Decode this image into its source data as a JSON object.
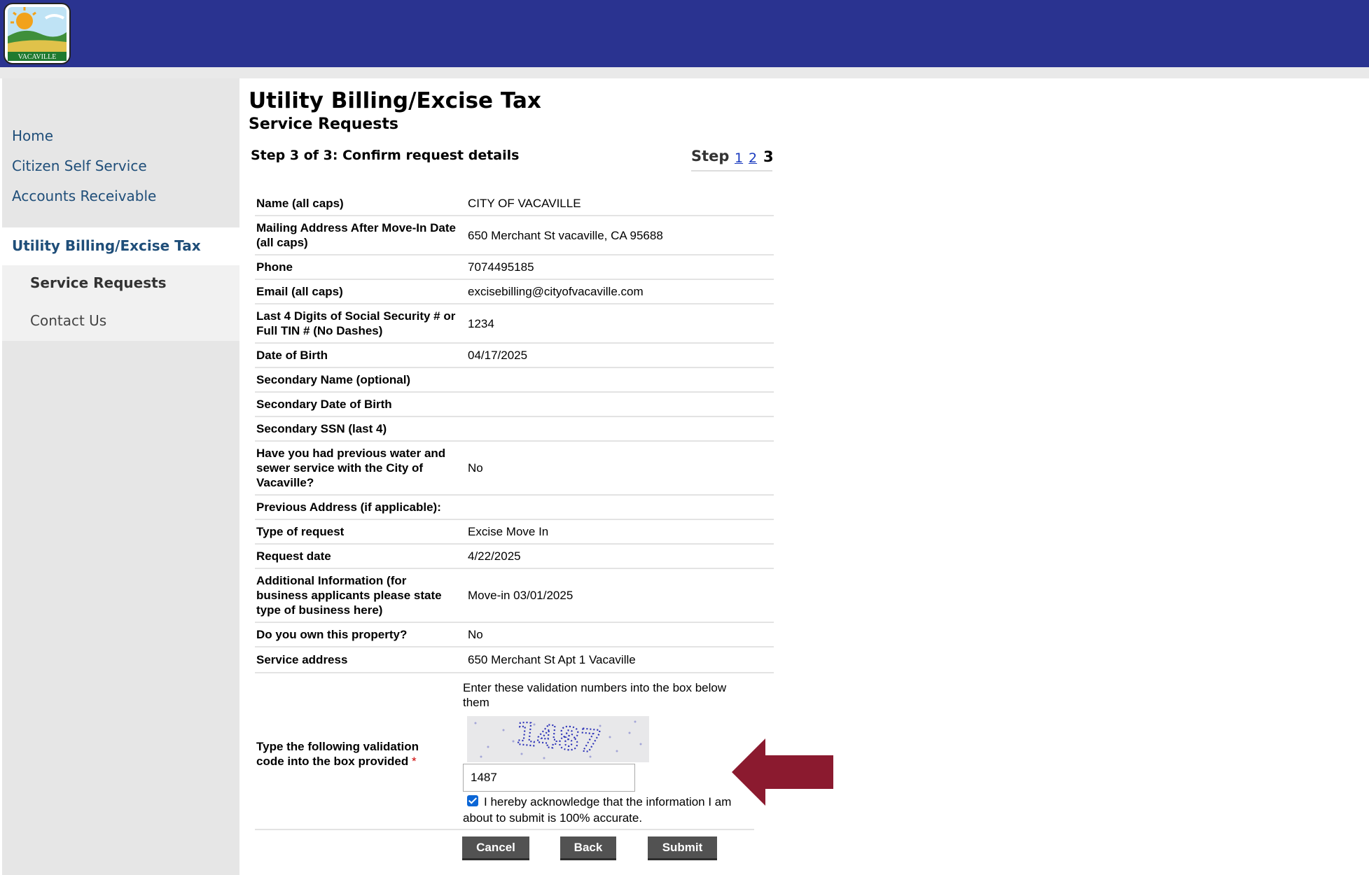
{
  "header": {
    "logo_text": "VACAVILLE"
  },
  "sidebar": {
    "items": [
      {
        "label": "Home"
      },
      {
        "label": "Citizen Self Service"
      },
      {
        "label": "Accounts Receivable"
      },
      {
        "label": "Utility Billing/Excise Tax"
      }
    ],
    "subitems": [
      {
        "label": "Service Requests"
      },
      {
        "label": "Contact Us"
      }
    ]
  },
  "main": {
    "title": "Utility Billing/Excise Tax",
    "subtitle": "Service Requests",
    "step_title": "Step 3 of 3: Confirm request details",
    "step_nav": {
      "label": "Step",
      "links": [
        "1",
        "2"
      ],
      "current": "3"
    }
  },
  "details": [
    {
      "label": "Name (all caps)",
      "value": "CITY OF VACAVILLE"
    },
    {
      "label": "Mailing Address After Move-In Date (all caps)",
      "value": "650 Merchant St vacaville, CA 95688"
    },
    {
      "label": "Phone",
      "value": "7074495185"
    },
    {
      "label": "Email (all caps)",
      "value": "excisebilling@cityofvacaville.com"
    },
    {
      "label": "Last 4 Digits of Social Security # or Full TIN # (No Dashes)",
      "value": "1234"
    },
    {
      "label": "Date of Birth",
      "value": "04/17/2025"
    },
    {
      "label": "Secondary Name (optional)",
      "value": ""
    },
    {
      "label": "Secondary Date of Birth",
      "value": ""
    },
    {
      "label": "Secondary SSN (last 4)",
      "value": ""
    },
    {
      "label": "Have you had previous water and sewer service with the City of Vacaville?",
      "value": "No"
    },
    {
      "label": "Previous Address (if applicable):",
      "value": ""
    },
    {
      "label": "Type of request",
      "value": "Excise Move In"
    },
    {
      "label": "Request date",
      "value": "4/22/2025"
    },
    {
      "label": "Additional Information (for business applicants please state type of business here)",
      "value": "Move-in 03/01/2025"
    },
    {
      "label": "Do you own this property?",
      "value": "No"
    },
    {
      "label": "Service address",
      "value": "650 Merchant St Apt 1 Vacaville"
    }
  ],
  "captcha": {
    "label": "Type the following validation code into the box provided",
    "required_marker": "*",
    "instructions": "Enter these validation numbers into the box below them",
    "image_code": "1487",
    "input_value": "1487",
    "acknowledge_checked": true,
    "acknowledge_text": "I hereby acknowledge that the information I am about to submit is 100% accurate."
  },
  "buttons": {
    "cancel": "Cancel",
    "back": "Back",
    "submit": "Submit"
  },
  "colors": {
    "header": "#2a3390",
    "nav_text": "#1f4e79",
    "button": "#525252",
    "arrow": "#8b1a2f"
  }
}
